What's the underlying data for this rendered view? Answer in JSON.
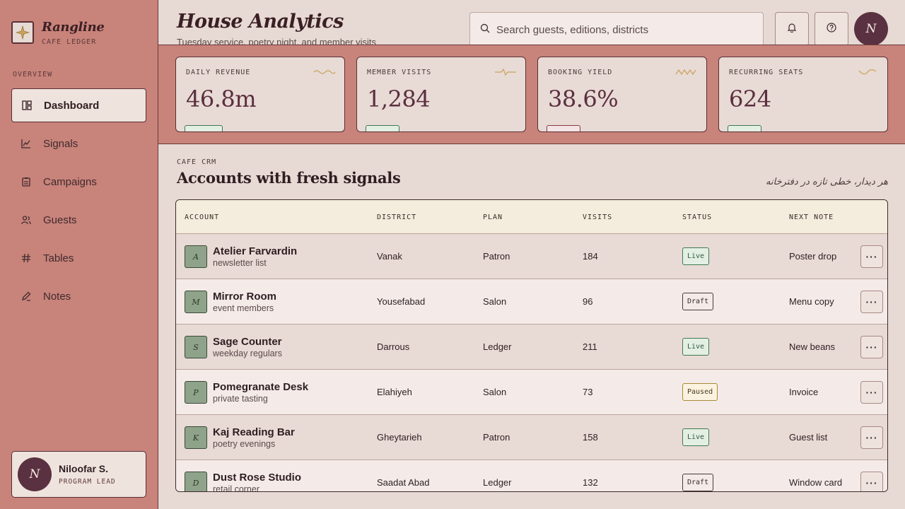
{
  "sidebar": {
    "brand_name": "Rangline",
    "brand_sub": "CAFE LEDGER",
    "section_label": "OVERVIEW",
    "items": [
      {
        "label": "Dashboard",
        "icon": "layout-icon",
        "active": true
      },
      {
        "label": "Signals",
        "icon": "line-chart-icon",
        "active": false
      },
      {
        "label": "Campaigns",
        "icon": "clipboard-icon",
        "active": false
      },
      {
        "label": "Guests",
        "icon": "users-icon",
        "active": false
      },
      {
        "label": "Tables",
        "icon": "hash-icon",
        "active": false
      },
      {
        "label": "Notes",
        "icon": "pen-icon",
        "active": false
      }
    ],
    "user": {
      "initial": "N",
      "name": "Niloofar S.",
      "role": "PROGRAM LEAD"
    }
  },
  "header": {
    "title": "House Analytics",
    "subtitle": "Tuesday service, poetry night, and member visits",
    "search_placeholder": "Search guests, editions, districts",
    "avatar_initial": "N"
  },
  "kpis": [
    {
      "label": "DAILY REVENUE",
      "value": "46.8m",
      "trend": "up"
    },
    {
      "label": "MEMBER VISITS",
      "value": "1,284",
      "trend": "up"
    },
    {
      "label": "BOOKING YIELD",
      "value": "38.6%",
      "trend": "down"
    },
    {
      "label": "RECURRING SEATS",
      "value": "624",
      "trend": "up"
    }
  ],
  "section": {
    "eyebrow": "CAFE CRM",
    "title": "Accounts with fresh signals",
    "persian_note": "هر دیدار، خطی تازه در دفترخانه"
  },
  "table": {
    "headers": {
      "account": "ACCOUNT",
      "district": "DISTRICT",
      "plan": "PLAN",
      "visits": "VISITS",
      "status": "STATUS",
      "next": "NEXT NOTE"
    },
    "rows": [
      {
        "initial": "A",
        "name": "Atelier Farvardin",
        "sub": "newsletter list",
        "district": "Vanak",
        "plan": "Patron",
        "visits": "184",
        "status": "Live",
        "status_kind": "live",
        "next": "Poster drop"
      },
      {
        "initial": "M",
        "name": "Mirror Room",
        "sub": "event members",
        "district": "Yousefabad",
        "plan": "Salon",
        "visits": "96",
        "status": "Draft",
        "status_kind": "draft",
        "next": "Menu copy"
      },
      {
        "initial": "S",
        "name": "Sage Counter",
        "sub": "weekday regulars",
        "district": "Darrous",
        "plan": "Ledger",
        "visits": "211",
        "status": "Live",
        "status_kind": "live",
        "next": "New beans"
      },
      {
        "initial": "P",
        "name": "Pomegranate Desk",
        "sub": "private tasting",
        "district": "Elahiyeh",
        "plan": "Salon",
        "visits": "73",
        "status": "Paused",
        "status_kind": "paused",
        "next": "Invoice"
      },
      {
        "initial": "K",
        "name": "Kaj Reading Bar",
        "sub": "poetry evenings",
        "district": "Gheytarieh",
        "plan": "Patron",
        "visits": "158",
        "status": "Live",
        "status_kind": "live",
        "next": "Guest list"
      },
      {
        "initial": "D",
        "name": "Dust Rose Studio",
        "sub": "retail corner",
        "district": "Saadat Abad",
        "plan": "Ledger",
        "visits": "132",
        "status": "Draft",
        "status_kind": "draft",
        "next": "Window card"
      }
    ]
  },
  "colors": {
    "sidebar_bg": "#c8837a",
    "accent": "#5a3140",
    "live": "#3f7a52",
    "paused": "#a88a3a"
  }
}
